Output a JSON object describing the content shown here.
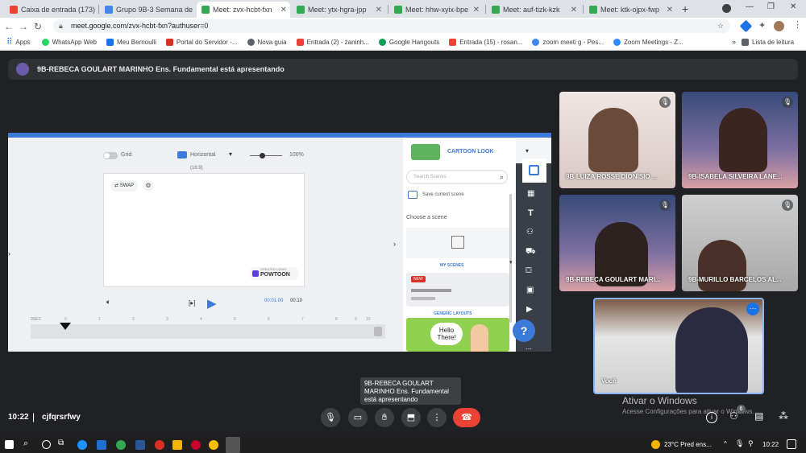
{
  "tabs": [
    {
      "label": "Caixa de entrada (173) -",
      "color": "#ea4335"
    },
    {
      "label": "Grupo 9B-3 Semana de",
      "color": "#4285f4"
    },
    {
      "label": "Meet: zvx-hcbt-fxn",
      "color": "#34a853"
    },
    {
      "label": "Meet: ytx-hgra-jpp",
      "color": "#34a853"
    },
    {
      "label": "Meet: hhw-xyix-bpe",
      "color": "#34a853"
    },
    {
      "label": "Meet: auf-tizk-kzk",
      "color": "#34a853"
    },
    {
      "label": "Meet: ktk-ojpx-fwp",
      "color": "#34a853"
    }
  ],
  "url": "meet.google.com/zvx-hcbt-fxn?authuser=0",
  "bookmarks": [
    {
      "label": "Apps",
      "color": "#5f6368"
    },
    {
      "label": "WhatsApp Web",
      "color": "#25d366"
    },
    {
      "label": "Meu Bernoulli",
      "color": "#1a73e8"
    },
    {
      "label": "Portal do Servidor -...",
      "color": "#d93025"
    },
    {
      "label": "Nova guia",
      "color": "#5f6368"
    },
    {
      "label": "Entrada (2) - zaninh...",
      "color": "#ea4335"
    },
    {
      "label": "Google Hangouts",
      "color": "#0f9d58"
    },
    {
      "label": "Entrada (15) - rosan...",
      "color": "#ea4335"
    },
    {
      "label": "zoom meeti g - Pes...",
      "color": "#4285f4"
    },
    {
      "label": "Zoom Meetings - Z...",
      "color": "#2d8cff"
    }
  ],
  "reading_list": "Lista de leitura",
  "presenting": "9B-REBECA GOULART MARINHO Ens. Fundamental está apresentando",
  "powtoon": {
    "grid": "Grid",
    "orientation": "Horizontal",
    "ratio": "(16:9)",
    "zoom": "100%",
    "swap": "SWAP",
    "logo_small": "CREATED USING",
    "logo": "POWTOON",
    "time_current": "00:01.00",
    "time_total": "00:10",
    "look": "CARTOON LOOK",
    "search_placeholder": "Search Scenes",
    "save": "Save current scene",
    "choose": "Choose a scene",
    "my_scenes": "MY SCENES",
    "new": "NEW",
    "generic": "GENERIC LAYOUTS",
    "hello1": "Hello",
    "hello2": "There!",
    "help": "?",
    "ticks": [
      "0",
      "1",
      "2",
      "3",
      "4",
      "5",
      "6",
      "7",
      "8",
      "9",
      "10"
    ],
    "sec": "0SEC"
  },
  "participants": [
    {
      "name": "9B-LUIZA ROSSE DIONÍSIO ..."
    },
    {
      "name": "9B-ISABELA SILVEIRA LANE..."
    },
    {
      "name": "9B-REBECA GOULART MARI..."
    },
    {
      "name": "9B-MURILLO BARCELOS AL..."
    },
    {
      "name": "Você"
    }
  ],
  "tooltip": "9B-REBECA GOULART MARINHO Ens. Fundamental está apresentando",
  "activate1": "Ativar o Windows",
  "activate2": "Acesse Configurações para ativar o Windows.",
  "clock": "10:22",
  "meeting_code": "cjfqrsrfwy",
  "people_badge": "6",
  "weather": "23°C  Pred ens...",
  "task_clock": "10:22"
}
